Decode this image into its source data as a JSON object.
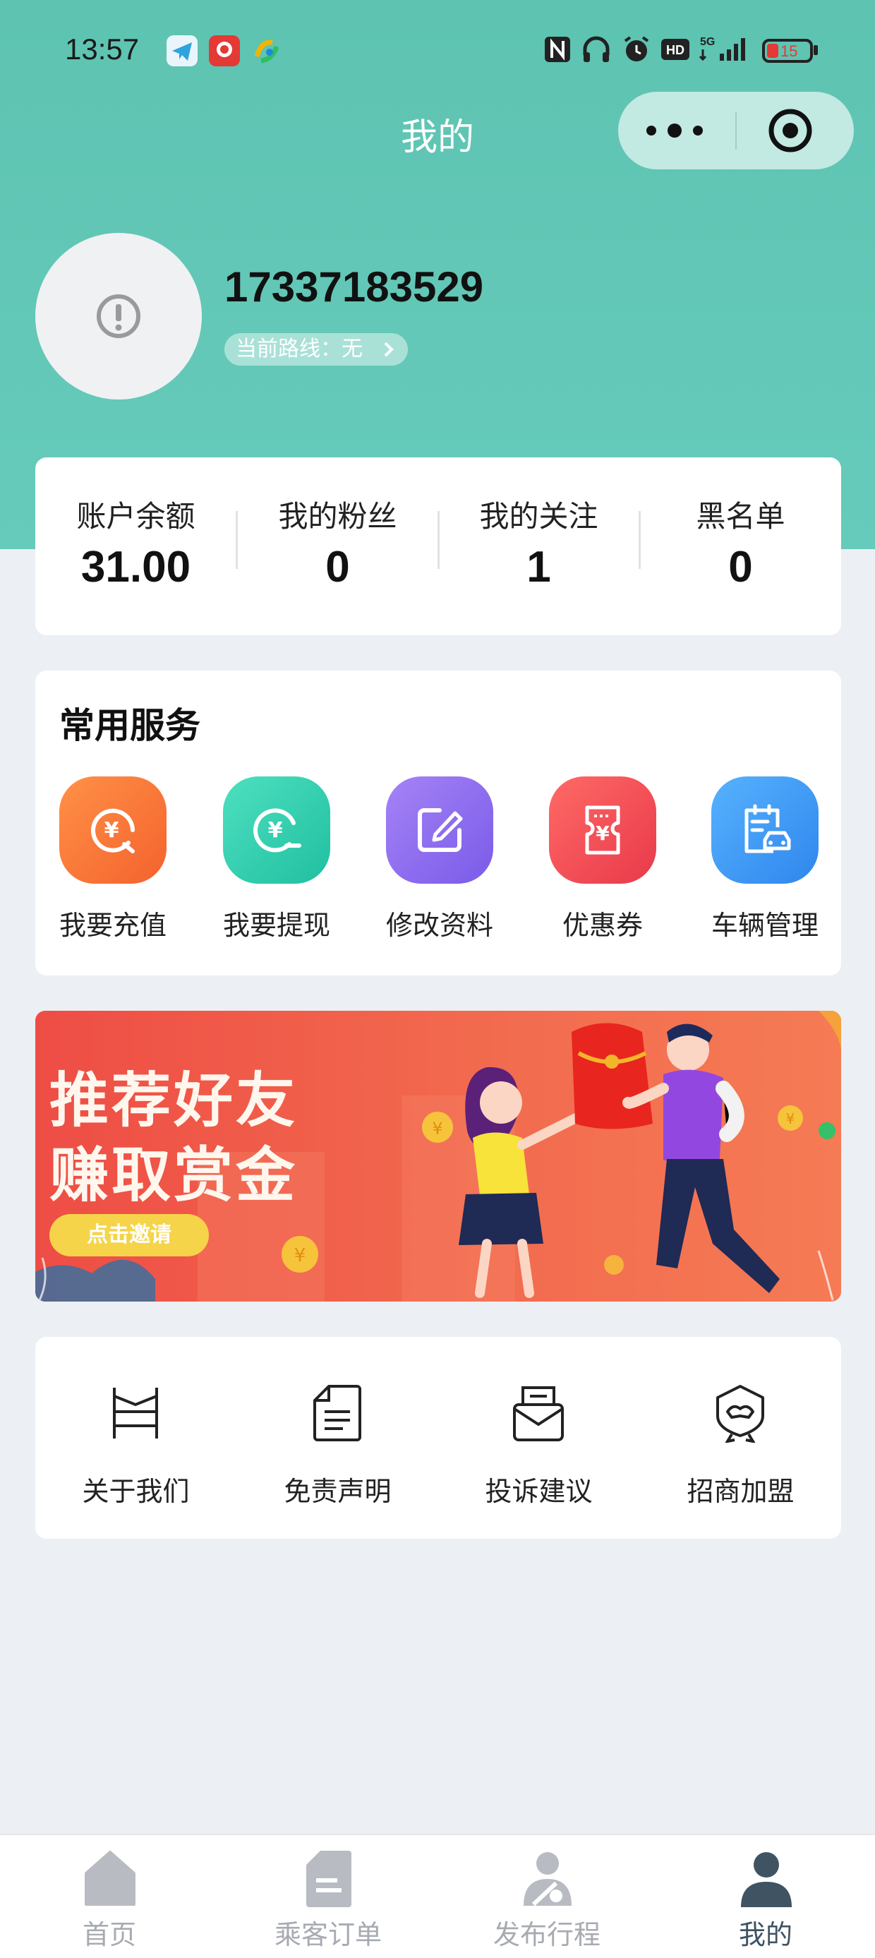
{
  "status_bar": {
    "time": "13:57",
    "battery": "15",
    "icons": [
      "telegram-icon",
      "app-red-icon",
      "app-color-icon",
      "nfc-icon",
      "headphones-icon",
      "alarm-icon",
      "hd-icon",
      "5g-signal-icon",
      "battery-icon"
    ]
  },
  "nav": {
    "title": "我的",
    "capsule_icons": [
      "more-icon",
      "close-target-icon"
    ]
  },
  "profile": {
    "phone": "17337183529",
    "route_label": "当前路线：无"
  },
  "stats": [
    {
      "label": "账户余额",
      "value": "31.00"
    },
    {
      "label": "我的粉丝",
      "value": "0"
    },
    {
      "label": "我的关注",
      "value": "1"
    },
    {
      "label": "黑名单",
      "value": "0"
    }
  ],
  "services": {
    "title": "常用服务",
    "items": [
      {
        "label": "我要充值",
        "icon": "recharge-icon",
        "color": "#f97a3c"
      },
      {
        "label": "我要提现",
        "icon": "withdraw-icon",
        "color": "#2fcfae"
      },
      {
        "label": "修改资料",
        "icon": "edit-icon",
        "color": "#8d6cf0"
      },
      {
        "label": "优惠券",
        "icon": "coupon-icon",
        "color": "#f04f55"
      },
      {
        "label": "车辆管理",
        "icon": "vehicle-icon",
        "color": "#3d9cf4"
      }
    ]
  },
  "banner": {
    "line1": "推荐好友",
    "line2": "赚取赏金",
    "button": "点击邀请"
  },
  "links": [
    {
      "label": "关于我们",
      "icon": "about-icon"
    },
    {
      "label": "免责声明",
      "icon": "document-icon"
    },
    {
      "label": "投诉建议",
      "icon": "mail-icon"
    },
    {
      "label": "招商加盟",
      "icon": "partner-icon"
    }
  ],
  "tabbar": [
    {
      "label": "首页",
      "icon": "home-icon"
    },
    {
      "label": "乘客订单",
      "icon": "order-icon"
    },
    {
      "label": "发布行程",
      "icon": "publish-trip-icon"
    },
    {
      "label": "我的",
      "icon": "profile-icon",
      "active": true
    }
  ]
}
